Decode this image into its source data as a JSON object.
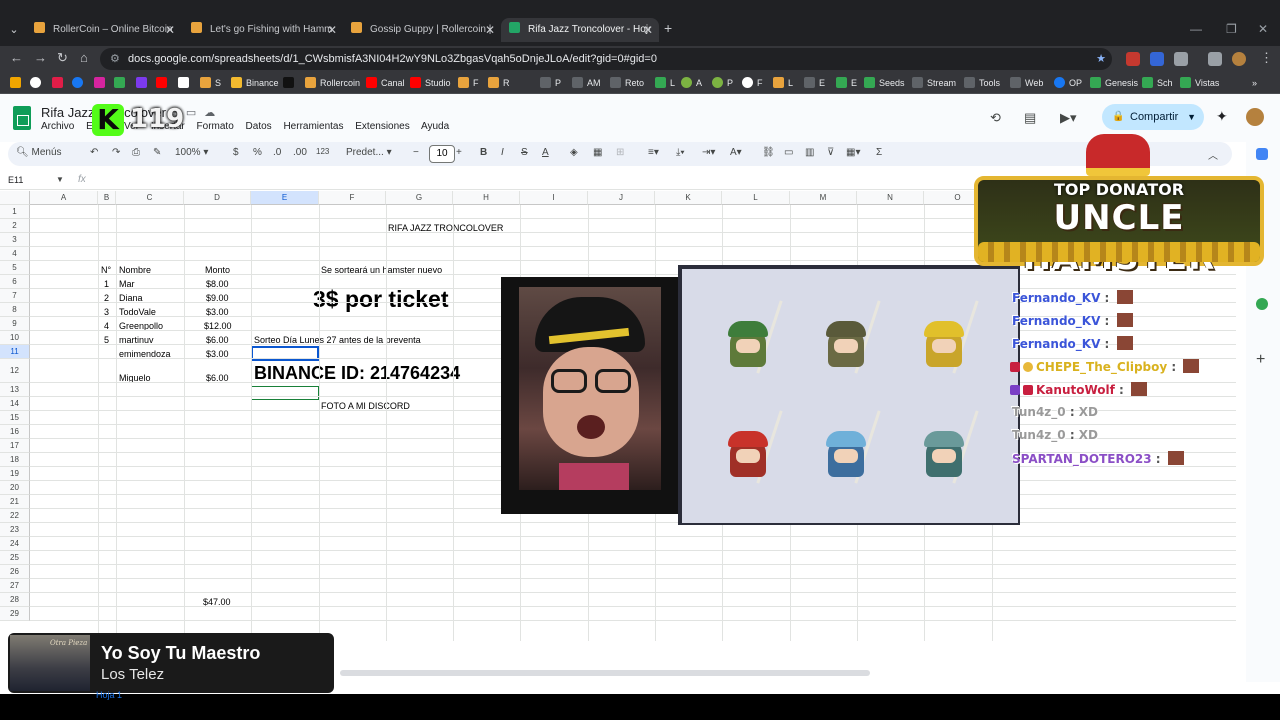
{
  "browser": {
    "tabs": [
      {
        "title": "RollerCoin – Online Bitcoin Min"
      },
      {
        "title": "Let's go Fishing with Hammy H"
      },
      {
        "title": "Gossip Guppy | Rollercoin | Mi"
      },
      {
        "title": "Rifa Jazz Troncolover - Hojas de"
      }
    ],
    "url": "docs.google.com/spreadsheets/d/1_CWsbmisfA3NI04H2wY9NLo3ZbgasVqah5oDnjeJLoA/edit?gid=0#gid=0",
    "bookmarks": [
      "S",
      "Binance",
      "Rollercoin",
      "Canal",
      "Studio",
      "F",
      "R",
      "P",
      "AM",
      "Reto",
      "L",
      "A",
      "P",
      "F",
      "L",
      "E",
      "E",
      "Seeds",
      "Stream",
      "Tools",
      "Web",
      "OP",
      "Genesis",
      "Sch",
      "Vistas"
    ]
  },
  "sheets": {
    "title": "Rifa Jazz Troncolover",
    "menus": [
      "Archivo",
      "Editar",
      "Ver",
      "Insertar",
      "Formato",
      "Datos",
      "Herramientas",
      "Extensiones",
      "Ayuda"
    ],
    "share_label": "Compartir",
    "toolbar": {
      "search": "Menús",
      "zoom": "100%",
      "currency": "$",
      "percent": "%",
      "dec_less": ".0",
      "dec_more": ".00",
      "number_format": "123",
      "font": "Predet...",
      "font_size": "10"
    },
    "name_box": "E11",
    "fx": "fx",
    "columns": [
      "A",
      "B",
      "C",
      "D",
      "E",
      "F",
      "G",
      "H",
      "I",
      "J",
      "K",
      "L",
      "M",
      "N",
      "O"
    ],
    "rows": [
      "1",
      "2",
      "3",
      "4",
      "5",
      "6",
      "7",
      "8",
      "9",
      "10",
      "11",
      "12",
      "13",
      "14",
      "15",
      "16",
      "17",
      "18",
      "19",
      "20",
      "21",
      "22",
      "23",
      "24",
      "25",
      "26",
      "27",
      "28",
      "29"
    ],
    "cells": {
      "raffle_title": "RIFA JAZZ TRONCOLOVER",
      "hdr_num": "N°",
      "hdr_name": "Nombre",
      "hdr_amount": "Monto",
      "entries": [
        {
          "n": "1",
          "name": "Mar",
          "amount": "$8.00"
        },
        {
          "n": "2",
          "name": "Diana",
          "amount": "$9.00"
        },
        {
          "n": "3",
          "name": "TodoVale",
          "amount": "$3.00"
        },
        {
          "n": "4",
          "name": "Greenpollo",
          "amount": "$12.00"
        },
        {
          "n": "5",
          "name": "martinuv",
          "amount": "$6.00"
        },
        {
          "n": "",
          "name": "emimendoza",
          "amount": "$3.00"
        },
        {
          "n": "",
          "name": "Miguelo",
          "amount": "$6.00"
        }
      ],
      "hamster_note": "Se sorteará un hamster nuevo",
      "ticket_price": "3$ por ticket",
      "draw_note": "Sorteo Día Lunes 27 antes de la preventa",
      "binance_id": "BINANCE ID: 214764234",
      "discord_note": "FOTO A MI DISCORD",
      "total": "$47.00"
    },
    "sheet_tab": "Hoja 1"
  },
  "stream": {
    "viewer_count": "119",
    "donator_top": "TOP DONATOR",
    "donator_name": "UNCLE HAMSTER",
    "chat": [
      {
        "user": "Fernando_KV",
        "color": "#3b55d9",
        "msg": ""
      },
      {
        "user": "Fernando_KV",
        "color": "#3b55d9",
        "msg": ""
      },
      {
        "user": "Fernando_KV",
        "color": "#3b55d9",
        "msg": ""
      },
      {
        "user": "CHEPE_The_Clipboy",
        "color": "#d9b21f",
        "msg": ""
      },
      {
        "user": "KanutoWolf",
        "color": "#c81f3f",
        "msg": ""
      },
      {
        "user": "Tun4z_0",
        "color": "#9a9a9a",
        "msg": "XD"
      },
      {
        "user": "Tun4z_0",
        "color": "#9a9a9a",
        "msg": "XD"
      },
      {
        "user": "SPARTAN_DOTERO23",
        "color": "#8b4fc6",
        "msg": ""
      }
    ],
    "now_playing": {
      "song": "Yo Soy Tu Maestro",
      "artist": "Los Telez",
      "cover_caption": "Otra Pieza"
    }
  }
}
